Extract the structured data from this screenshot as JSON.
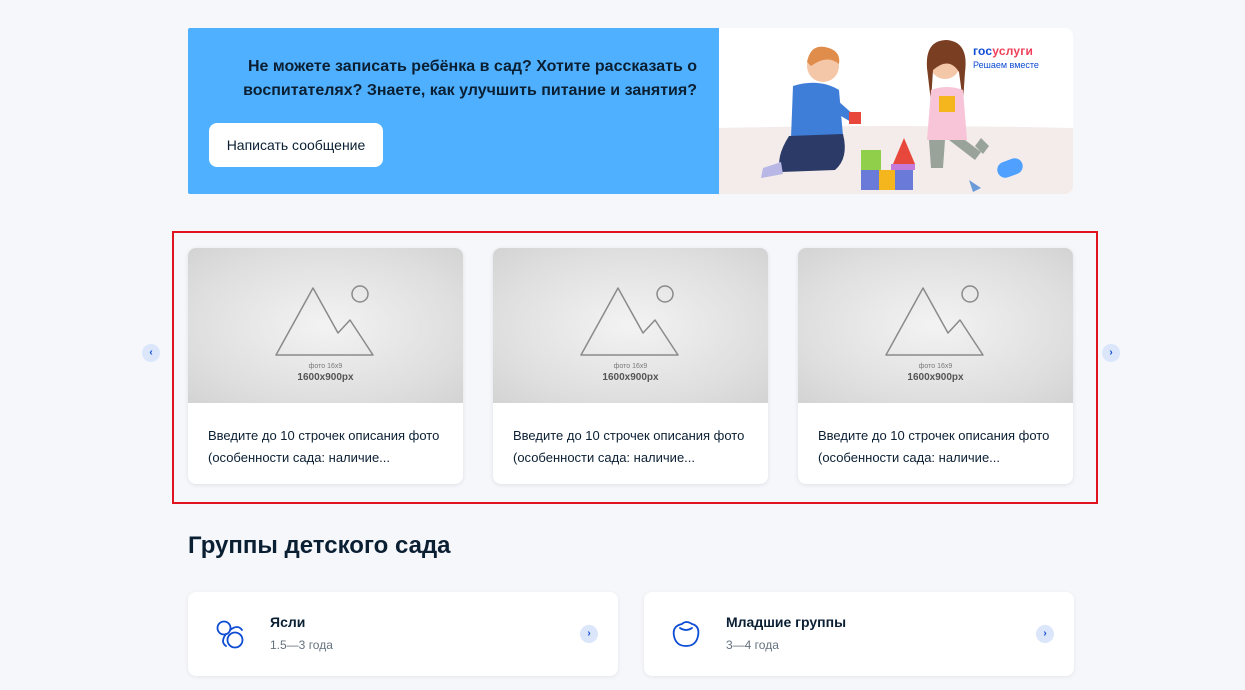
{
  "banner": {
    "text": "Не можете записать ребёнка в сад? Хотите рассказать о воспитателях? Знаете, как улучшить питание и занятия?",
    "button_label": "Написать сообщение",
    "brand_part1": "гос",
    "brand_part2": "услуги",
    "brand_tagline": "Решаем вместе"
  },
  "carousel": {
    "prev_arrow": "‹",
    "next_arrow": "›",
    "cards": [
      {
        "photo_ratio": "фото 16х9",
        "photo_size": "1600х900px",
        "description": "Введите до 10 строчек описания фото (особенности сада: наличие..."
      },
      {
        "photo_ratio": "фото 16х9",
        "photo_size": "1600х900px",
        "description": "Введите до 10 строчек описания фото (особенности сада: наличие..."
      },
      {
        "photo_ratio": "фото 16х9",
        "photo_size": "1600х900px",
        "description": "Введите до 10 строчек описания фото (особенности сада: наличие..."
      }
    ]
  },
  "groups": {
    "title": "Группы детского сада",
    "items": [
      {
        "name": "Ясли",
        "age": "1.5—3 года",
        "icon": "pacifier-icon",
        "arrow": "›"
      },
      {
        "name": "Младшие группы",
        "age": "3—4 года",
        "icon": "child-face-icon",
        "arrow": "›"
      }
    ]
  },
  "colors": {
    "banner_bg": "#4fb0ff",
    "accent": "#0d4cd3",
    "highlight_frame": "#e0141e"
  }
}
